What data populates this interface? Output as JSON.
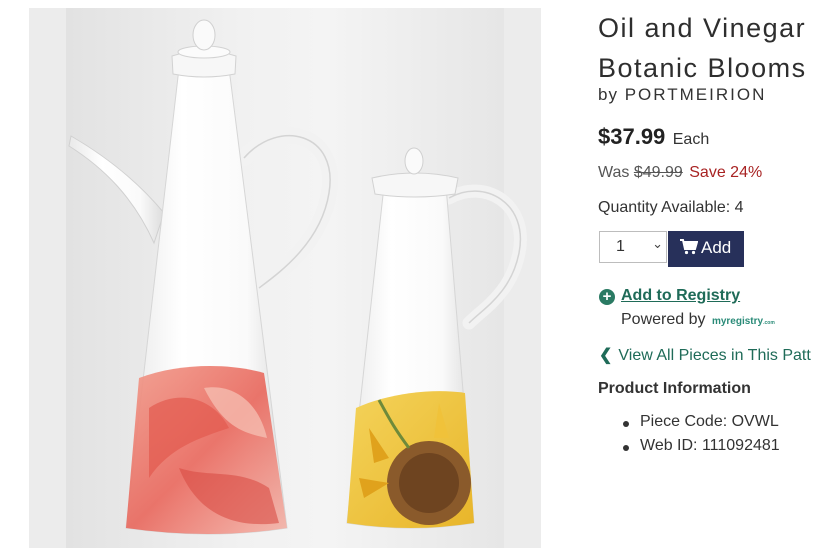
{
  "product": {
    "title_line1": "Oil and Vinegar",
    "title_line2": "Botanic Blooms",
    "brand_prefix": "by",
    "brand": "PORTMEIRION",
    "image_alt": "Oil and Vinegar cruets with poppy and sunflower decoration"
  },
  "pricing": {
    "price": "$37.99",
    "unit": "Each",
    "was_label": "Was",
    "was_price": "$49.99",
    "save_text": "Save 24%"
  },
  "quantity": {
    "available_text": "Quantity Available: 4",
    "selected": "1"
  },
  "add_button": {
    "label": "Add",
    "icon": "cart-icon"
  },
  "registry": {
    "link_label": "Add to Registry",
    "powered_label": "Powered by",
    "logo_text": "myregistry",
    "logo_suffix": ".com"
  },
  "view_all": {
    "label": "View All Pieces in This Patt"
  },
  "product_info": {
    "heading": "Product Information",
    "items": [
      "Piece Code: OVWL",
      "Web ID: 111092481"
    ]
  },
  "colors": {
    "accent_green": "#1f6b58",
    "button_navy": "#27305a",
    "sale_red": "#a82323"
  }
}
